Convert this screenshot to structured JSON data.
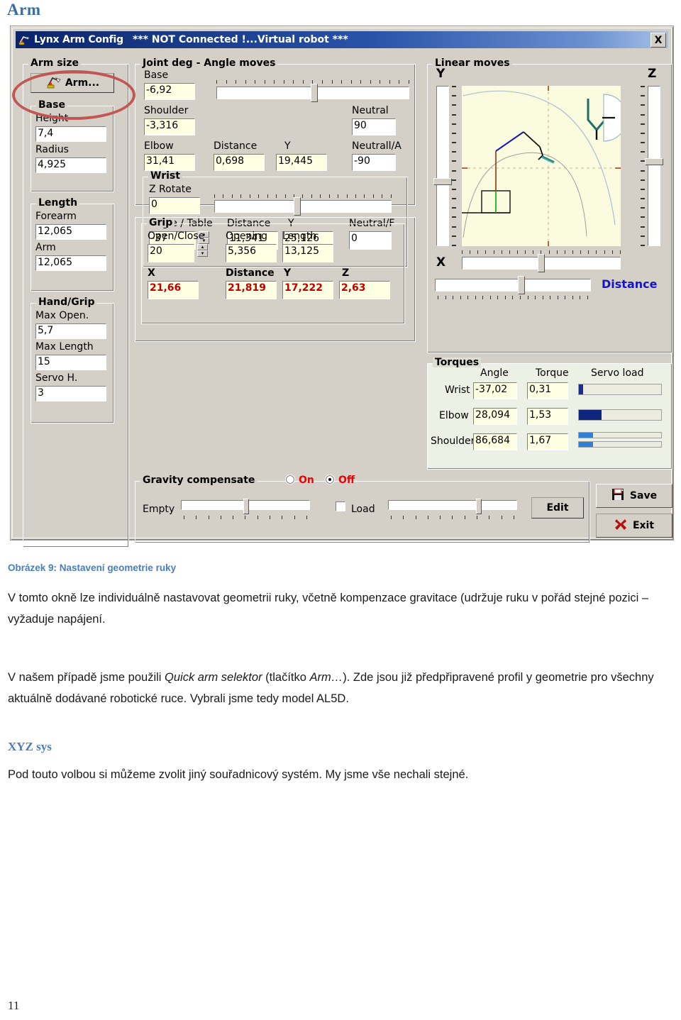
{
  "document": {
    "heading": "Arm",
    "caption": "Obrázek 9: Nastavení geometrie ruky",
    "paragraph1": "V tomto okně lze individuálně nastavovat geometrii ruky, včetně kompenzace gravitace (udržuje ruku v pořád stejné pozici – vyžaduje napájení.",
    "paragraph2_a": "V našem případě jsme použili ",
    "paragraph2_i1": "Quick arm selektor",
    "paragraph2_b": " (tlačítko ",
    "paragraph2_i2": "Arm…",
    "paragraph2_c": "). Zde jsou již předpřipravené profil y geometrie pro všechny aktuálně dodávané robotické ruce. Vybrali jsme tedy model AL5D.",
    "heading2": "XYZ sys",
    "paragraph3": "Pod touto volbou si můžeme zvolit jiný souřadnicový systém. My jsme vše nechali stejné.",
    "page_number": "11"
  },
  "window": {
    "title": "Lynx Arm Config",
    "status": "*** NOT Connected !...Virtual robot ***",
    "close_label": "X",
    "icon": "robot-arm-icon"
  },
  "arm_size": {
    "group_label": "Arm size",
    "arm_button_label": "Arm...",
    "base": {
      "group_label": "Base",
      "height_label": "Height",
      "height_value": "7,4",
      "radius_label": "Radius",
      "radius_value": "4,925"
    },
    "length": {
      "group_label": "Length",
      "forearm_label": "Forearm",
      "forearm_value": "12,065",
      "arm_label": "Arm",
      "arm_value": "12,065"
    },
    "hand_grip": {
      "group_label": "Hand/Grip",
      "max_open_label": "Max Open.",
      "max_open_value": "5,7",
      "max_length_label": "Max Length",
      "max_length_value": "15",
      "servo_h_label": "Servo H.",
      "servo_h_value": "3"
    }
  },
  "joint_deg": {
    "group_label": "Joint deg - Angle moves",
    "base_label": "Base",
    "base_value": "-6,92",
    "shoulder_label": "Shoulder",
    "shoulder_value": "-3,316",
    "neutral_label": "Neutral",
    "neutral_value": "90",
    "elbow_label": "Elbow",
    "elbow_value": "31,41",
    "distance_label": "Distance",
    "distance_value": "0,698",
    "y_label": "Y",
    "y_value": "19,445",
    "neutral_a_label": "Neutrall/A",
    "neutral_a_value": "-90"
  },
  "wrist": {
    "group_label": "Wrist",
    "z_rotate_label": "Z Rotate",
    "z_rotate_value": "0",
    "angle_table_label": "Angle / Table",
    "angle_table_value": "-37",
    "distance_label": "Distance",
    "distance_value": "11,341",
    "y_label": "Y",
    "y_value": "25,126",
    "neutral_f_label": "Neutral/F",
    "neutral_f_value": "0"
  },
  "grip": {
    "group_label": "Grip",
    "open_close_label": "Open/Close",
    "open_close_value": "20",
    "opening_label": "Opening",
    "opening_value": "5,356",
    "length_label": "Length",
    "length_value": "13,125",
    "x_label": "X",
    "x_value": "21,66",
    "distance_label": "Distance",
    "distance_value": "21,819",
    "y_label": "Y",
    "y_value": "17,222",
    "z_label": "Z",
    "z_value": "2,63"
  },
  "linear_moves": {
    "group_label": "Linear moves",
    "y_label": "Y",
    "z_label": "Z",
    "x_label": "X",
    "distance_label": "Distance"
  },
  "torques": {
    "group_label": "Torques",
    "col_angle": "Angle",
    "col_torque": "Torque",
    "col_servo_load": "Servo load",
    "rows": [
      {
        "name": "Wrist",
        "angle": "-37,02",
        "torque": "0,31",
        "load_pct": 4,
        "color": "#1b2f8a"
      },
      {
        "name": "Elbow",
        "angle": "28,094",
        "torque": "1,53",
        "load_pct": 27,
        "color": "#10267e"
      },
      {
        "name": "Shoulder",
        "angle": "86,684",
        "torque": "1,67",
        "load_pct": 17,
        "color": "#2f7fd4"
      }
    ]
  },
  "gravity": {
    "group_label": "Gravity compensate",
    "on_label": "On",
    "off_label": "Off",
    "selected": "Off",
    "empty_label": "Empty",
    "load_label": "Load",
    "load_checked": false,
    "edit_label": "Edit"
  },
  "actions": {
    "save_label": "Save",
    "exit_label": "Exit"
  },
  "colors": {
    "accent_blue": "#4a7ebb",
    "titlebar": "#0a246a",
    "field_bg": "#ffffe4",
    "red_value": "#c00000",
    "annotation": "#c0504d"
  }
}
